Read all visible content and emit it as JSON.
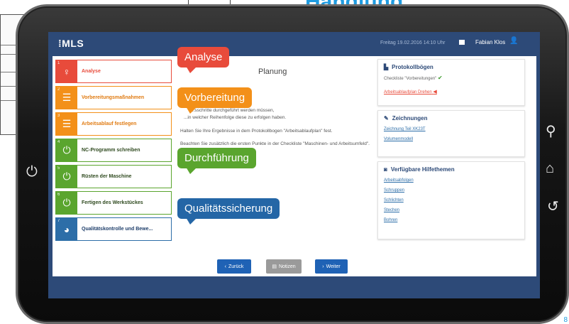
{
  "background": {
    "title": "Handlung",
    "corner_text": "8"
  },
  "topbar": {
    "logo": "⁞MLS",
    "datetime": "Freitag 19.02.2016 14:10 Uhr",
    "user": "Fabian Klos"
  },
  "steps": [
    {
      "num": "1",
      "label": "Analyse",
      "color": "red",
      "icon": "lightbulb-icon"
    },
    {
      "num": "2",
      "label": "Vorbereitungsmaßnahmen",
      "color": "orange",
      "icon": "list-icon"
    },
    {
      "num": "3",
      "label": "Arbeitsablauf festlegen",
      "color": "orange",
      "icon": "list-icon"
    },
    {
      "num": "4",
      "label": "NC-Programm schreiben",
      "color": "green",
      "icon": "power-icon"
    },
    {
      "num": "5",
      "label": "Rüsten der Maschine",
      "color": "green",
      "icon": "power-icon"
    },
    {
      "num": "6",
      "label": "Fertigen des Werkstückes",
      "color": "green",
      "icon": "power-icon"
    },
    {
      "num": "7",
      "label": "Qualitätskontrolle und Bewe...",
      "color": "blue",
      "icon": "pie-chart-icon"
    }
  ],
  "main": {
    "title": "Planung",
    "para1": "...sschritte durchgeführt werden müssen,",
    "para1b": "...in welcher Reihenfolge diese zu erfolgen haben.",
    "para2": "Halten Sie Ihre Ergebnisse in dem Protokollbogen \"Arbeitsablaufplan\" fest.",
    "para3": "Beachten Sie zusätzlich die ersten Punkte in der Checkliste \"Maschinen- und Arbeitsumfeld\"."
  },
  "panels": {
    "protokoll": {
      "title": "Protokollbögen",
      "checklist": "Checkliste \"Vorbereitungen\"",
      "arbeitsablauf": "Arbeitsablaufplan Drehen"
    },
    "zeichnungen": {
      "title": "Zeichnungen",
      "items": [
        "Zeichnung Teil XK23T",
        "Volumenmodell"
      ]
    },
    "hilfe": {
      "title": "Verfügbare Hilfethemen",
      "items": [
        "Arbeitsabfolgen",
        "Schruppen",
        "Schlichten",
        "Stechen",
        "Bohren"
      ]
    }
  },
  "buttons": {
    "back": "Zurück",
    "notes": "Notizen",
    "next": "Weiter"
  },
  "callouts": {
    "analyse": "Analyse",
    "vorbereitung": "Vorbereitung",
    "durchfuehrung": "Durchführung",
    "qualitaet": "Qualitätssicherung"
  }
}
